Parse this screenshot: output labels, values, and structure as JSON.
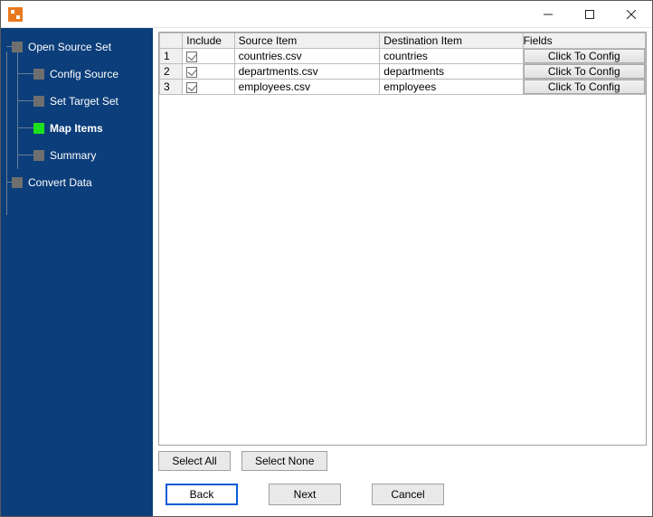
{
  "window": {
    "title": ""
  },
  "sidebar": {
    "items": [
      {
        "label": "Open Source Set",
        "level": 0,
        "active": false
      },
      {
        "label": "Config Source",
        "level": 1,
        "active": false
      },
      {
        "label": "Set Target Set",
        "level": 1,
        "active": false
      },
      {
        "label": "Map Items",
        "level": 1,
        "active": true
      },
      {
        "label": "Summary",
        "level": 1,
        "active": false
      },
      {
        "label": "Convert Data",
        "level": 0,
        "active": false
      }
    ]
  },
  "grid": {
    "columns": {
      "include": "Include",
      "source": "Source Item",
      "dest": "Destination Item",
      "fields": "Fields"
    },
    "config_button_label": "Click To Config",
    "rows": [
      {
        "n": "1",
        "include": true,
        "source": "countries.csv",
        "dest": "countries"
      },
      {
        "n": "2",
        "include": true,
        "source": "departments.csv",
        "dest": "departments"
      },
      {
        "n": "3",
        "include": true,
        "source": "employees.csv",
        "dest": "employees"
      }
    ]
  },
  "selection": {
    "select_all": "Select All",
    "select_none": "Select None"
  },
  "nav": {
    "back": "Back",
    "next": "Next",
    "cancel": "Cancel"
  }
}
